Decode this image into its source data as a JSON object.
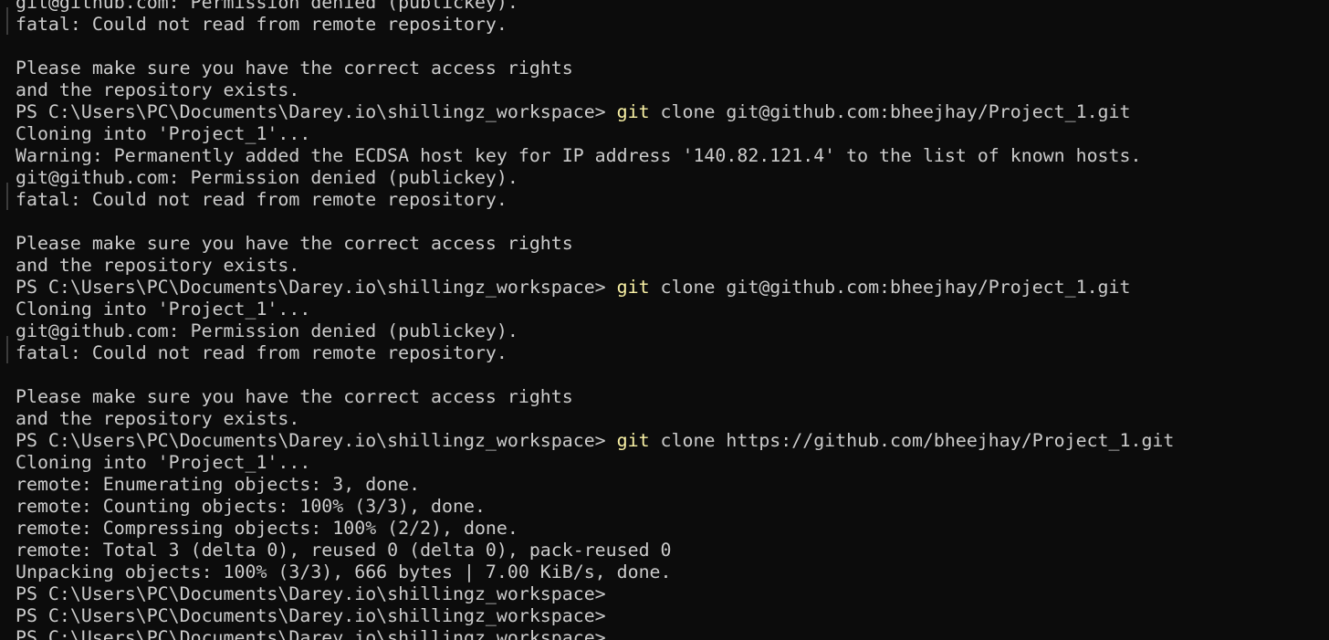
{
  "terminal": {
    "lines": [
      {
        "text": "git@github.com: Permission denied (publickey)."
      },
      {
        "text": "fatal: Could not read from remote repository."
      },
      {
        "text": ""
      },
      {
        "text": "Please make sure you have the correct access rights"
      },
      {
        "text": "and the repository exists."
      },
      {
        "prompt": "PS C:\\Users\\PC\\Documents\\Darey.io\\shillingz_workspace> ",
        "command": "git",
        "args": " clone git@github.com:bheejhay/Project_1.git"
      },
      {
        "text": "Cloning into 'Project_1'..."
      },
      {
        "text": "Warning: Permanently added the ECDSA host key for IP address '140.82.121.4' to the list of known hosts."
      },
      {
        "text": "git@github.com: Permission denied (publickey)."
      },
      {
        "text": "fatal: Could not read from remote repository."
      },
      {
        "text": ""
      },
      {
        "text": "Please make sure you have the correct access rights"
      },
      {
        "text": "and the repository exists."
      },
      {
        "prompt": "PS C:\\Users\\PC\\Documents\\Darey.io\\shillingz_workspace> ",
        "command": "git",
        "args": " clone git@github.com:bheejhay/Project_1.git"
      },
      {
        "text": "Cloning into 'Project_1'..."
      },
      {
        "text": "git@github.com: Permission denied (publickey)."
      },
      {
        "text": "fatal: Could not read from remote repository."
      },
      {
        "text": ""
      },
      {
        "text": "Please make sure you have the correct access rights"
      },
      {
        "text": "and the repository exists."
      },
      {
        "prompt": "PS C:\\Users\\PC\\Documents\\Darey.io\\shillingz_workspace> ",
        "command": "git",
        "args": " clone https://github.com/bheejhay/Project_1.git"
      },
      {
        "text": "Cloning into 'Project_1'..."
      },
      {
        "text": "remote: Enumerating objects: 3, done."
      },
      {
        "text": "remote: Counting objects: 100% (3/3), done."
      },
      {
        "text": "remote: Compressing objects: 100% (2/2), done."
      },
      {
        "text": "remote: Total 3 (delta 0), reused 0 (delta 0), pack-reused 0"
      },
      {
        "text": "Unpacking objects: 100% (3/3), 666 bytes | 7.00 KiB/s, done."
      },
      {
        "prompt": "PS C:\\Users\\PC\\Documents\\Darey.io\\shillingz_workspace>"
      },
      {
        "prompt": "PS C:\\Users\\PC\\Documents\\Darey.io\\shillingz_workspace>"
      },
      {
        "prompt": "PS C:\\Users\\PC\\Documents\\Darey.io\\shillingz_workspace>"
      }
    ]
  },
  "colors": {
    "background": "#0c0c0c",
    "foreground": "#cccccc",
    "command": "#f9f1a5"
  }
}
